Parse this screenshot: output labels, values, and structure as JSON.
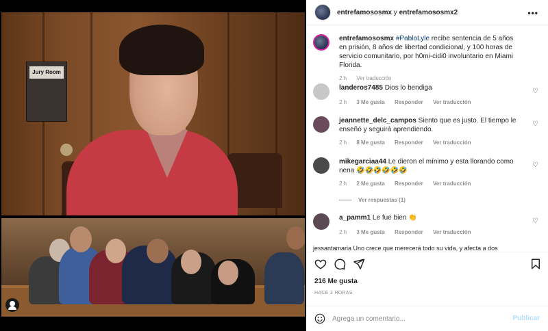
{
  "header": {
    "user1": "entrefamososmx",
    "connector": " y ",
    "user2": "entrefamososmx2",
    "more_icon": "more-dots-icon"
  },
  "media": {
    "sign_text": "Jury Room",
    "user_tag_icon": "user-tag-icon"
  },
  "caption": {
    "user": "entrefamososmx",
    "tag": "#PabloLyle",
    "text": " recibe sentencia de 5 años en prisión, 8 años de libertad condicional, y 100 horas de servicio comunitario, por h0mi-cidi0 involuntario en Miami Florida.",
    "time": "2 h",
    "translation": "Ver traducción"
  },
  "comments": [
    {
      "user": "landeros7485",
      "text": "Dios lo bendiga",
      "time": "2 h",
      "likes": "3 Me gusta",
      "reply": "Responder",
      "translation": "Ver traducción",
      "avatar_color": "#c7c7c7"
    },
    {
      "user": "jeannette_delc_campos",
      "text": "Siento que es justo. El tiempo le enseñó y seguirá aprendiendo.",
      "time": "2 h",
      "likes": "8 Me gusta",
      "reply": "Responder",
      "translation": "Ver traducción",
      "avatar_color": "#6a4b5e"
    },
    {
      "user": "mikegarciaa44",
      "text": "Le dieron el mínimo y esta llorando como nena 🤣🤣🤣🤣🤣🤣",
      "time": "2 h",
      "likes": "2 Me gusta",
      "reply": "Responder",
      "translation": "Ver traducción",
      "avatar_color": "#4a4a4a"
    },
    {
      "user": "a_pamm1",
      "text": "Le fue bien 👏",
      "time": "2 h",
      "likes": "3 Me gusta",
      "reply": "Responder",
      "translation": "Ver traducción",
      "avatar_color": "#5b4a52"
    }
  ],
  "replies_label": "Ver respuestas (1)",
  "cut_comment": "jessantamaria Uno crece que merecerá todo su vida, y afecta a dos",
  "actions": {
    "like_icon": "heart-icon",
    "comment_icon": "comment-icon",
    "share_icon": "share-icon",
    "save_icon": "bookmark-icon"
  },
  "likes": "216 Me gusta",
  "time": "HACE 2 HORAS",
  "add_comment": {
    "placeholder": "Agrega un comentario...",
    "publish": "Publicar",
    "emoji_icon": "emoji-icon"
  },
  "colors": {
    "link": "#00376b",
    "muted": "#8e8e8e",
    "publish": "#b2dffc"
  }
}
